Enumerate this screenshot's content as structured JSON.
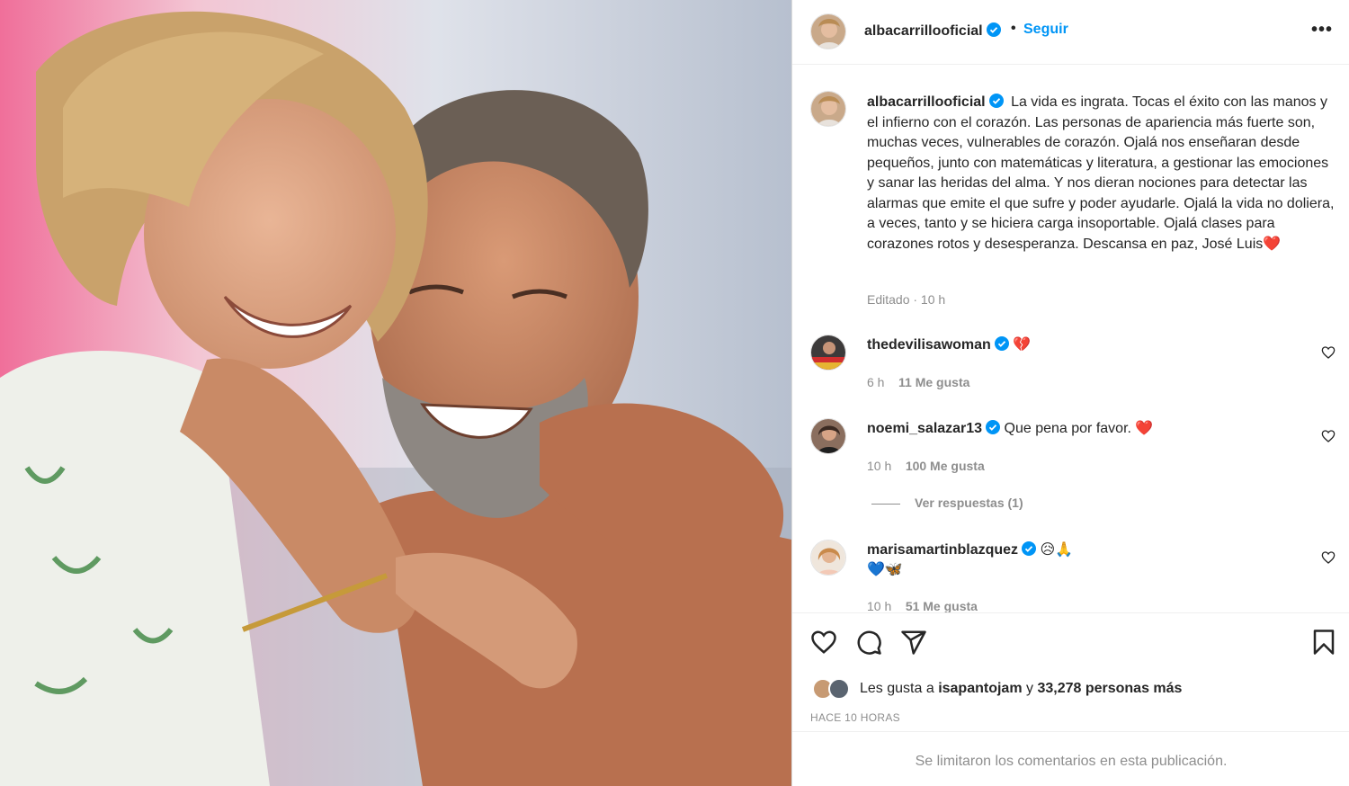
{
  "post": {
    "username": "albacarrillooficial",
    "follow_label": "Seguir",
    "separator": "•",
    "more_label": "•••"
  },
  "caption": {
    "username": "albacarrillooficial",
    "text": "La vida es ingrata. Tocas el éxito con las manos y el infierno con el corazón. Las personas de apariencia más fuerte son, muchas veces, vulnerables de corazón. Ojalá nos enseñaran desde pequeños, junto con matemáticas y literatura, a gestionar las emociones y sanar las heridas del alma. Y nos dieran nociones para detectar las alarmas que emite el que sufre y poder ayudarle. Ojalá la vida no doliera, a veces, tanto y se hiciera carga insoportable. Ojalá clases para corazones rotos y desesperanza. Descansa en paz, José Luis",
    "emoji": "❤️",
    "meta": "Editado · 10 h"
  },
  "comments": [
    {
      "username": "thedevilisawoman",
      "text": "💔",
      "time": "6 h",
      "likes": "11 Me gusta"
    },
    {
      "username": "noemi_salazar13",
      "text": "Que pena por favor. ❤️",
      "time": "10 h",
      "likes": "100 Me gusta",
      "replies": "Ver respuestas (1)"
    },
    {
      "username": "marisamartinblazquez",
      "text": "😥🙏",
      "text2": "💙🦋",
      "time": "10 h",
      "likes": "51 Me gusta"
    }
  ],
  "likes": {
    "prefix": "Les gusta a",
    "user": "isapantojam",
    "connector": "y",
    "count": "33,278 personas más"
  },
  "time_ago": "HACE 10 HORAS",
  "limited_notice": "Se limitaron los comentarios en esta publicación.",
  "icons": [
    "heart-icon",
    "comment-icon",
    "share-icon",
    "bookmark-icon",
    "verified-icon",
    "more-icon"
  ],
  "colors": {
    "link_blue": "#0095f6",
    "verified_blue": "#0095f6",
    "text": "#262626",
    "muted": "#8e8e8e",
    "red_heart": "#ed4956"
  }
}
